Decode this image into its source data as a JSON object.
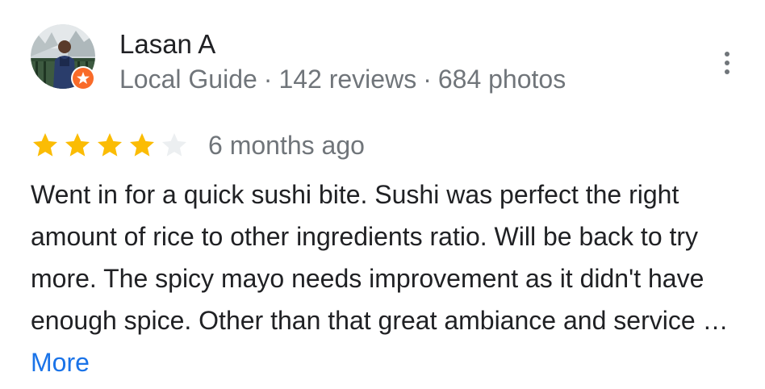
{
  "reviewer": {
    "name": "Lasan A",
    "badge": "Local Guide",
    "reviews": "142 reviews",
    "photos": "684 photos",
    "separator": "·"
  },
  "rating": {
    "value": 4,
    "max": 5,
    "filled_color": "#fbbc04",
    "empty_color": "#eceff1"
  },
  "review": {
    "date": "6 months ago",
    "text": "Went in for a quick sushi bite. Sushi was perfect the right amount of rice to other ingredients ratio. Will be back to try more. The spicy mayo needs improvement as it didn't have enough spice. Other than that great ambiance and service …",
    "more_label": "More"
  },
  "icons": {
    "guide_badge": "local-guide-star-badge",
    "menu": "more-vertical-dots"
  },
  "colors": {
    "primary_text": "#202124",
    "secondary_text": "#70757a",
    "link": "#1a73e8",
    "badge": "#f96b29"
  }
}
